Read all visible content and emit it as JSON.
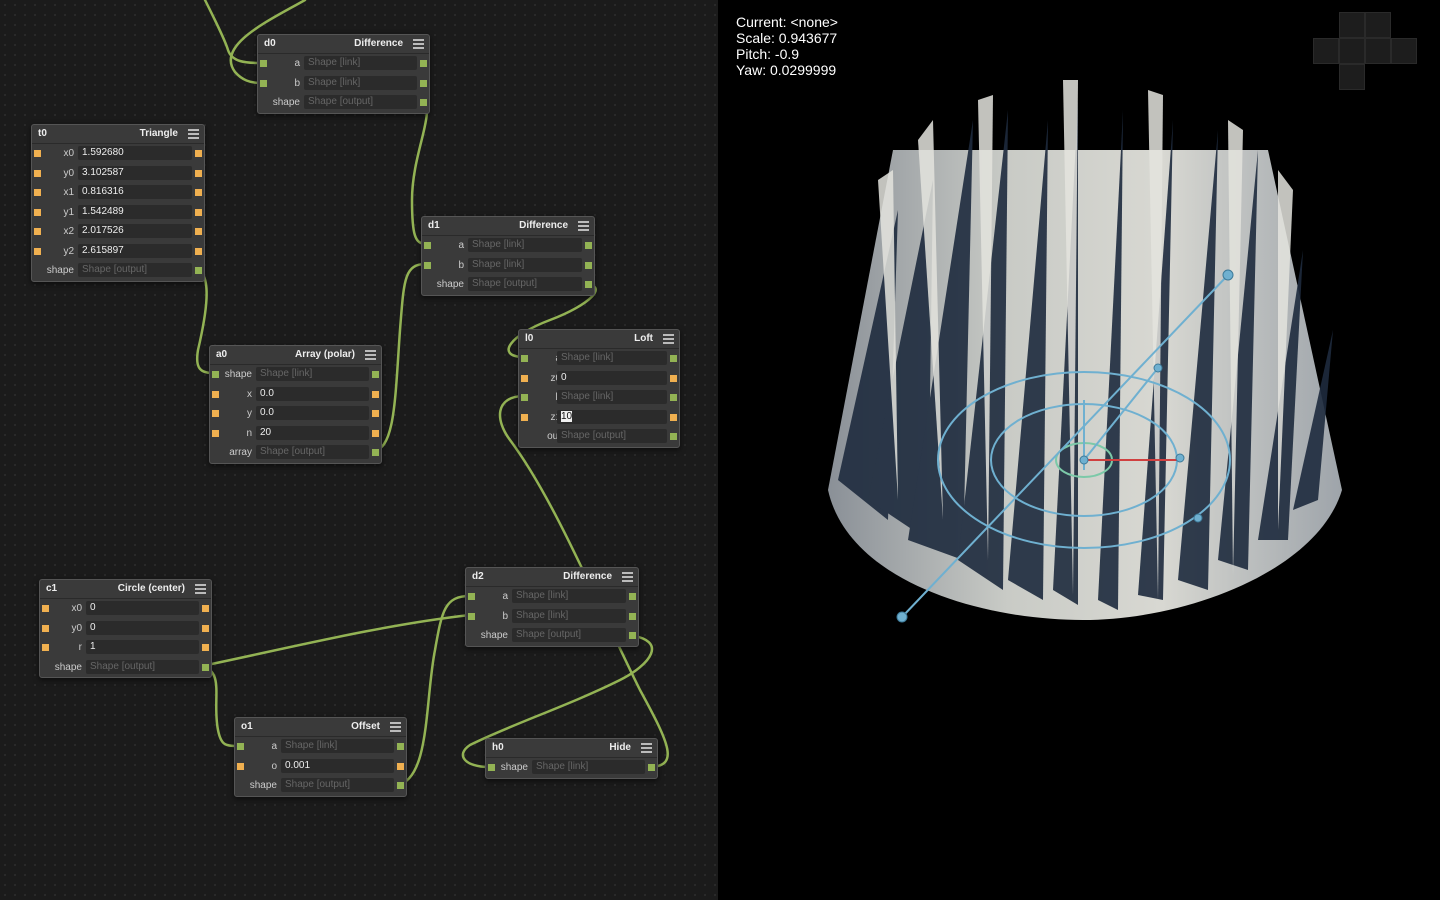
{
  "nodes": {
    "d0": {
      "id": "d0",
      "type": "Difference",
      "rows": [
        {
          "label": "a",
          "value": "Shape [link]"
        },
        {
          "label": "b",
          "value": "Shape [link]"
        },
        {
          "label": "shape",
          "value": "Shape [output]"
        }
      ]
    },
    "t0": {
      "id": "t0",
      "type": "Triangle",
      "rows": [
        {
          "label": "x0",
          "value": "1.592680"
        },
        {
          "label": "y0",
          "value": "3.102587"
        },
        {
          "label": "x1",
          "value": "0.816316"
        },
        {
          "label": "y1",
          "value": "1.542489"
        },
        {
          "label": "x2",
          "value": "2.017526"
        },
        {
          "label": "y2",
          "value": "2.615897"
        },
        {
          "label": "shape",
          "value": "Shape [output]"
        }
      ]
    },
    "d1": {
      "id": "d1",
      "type": "Difference",
      "rows": [
        {
          "label": "a",
          "value": "Shape [link]"
        },
        {
          "label": "b",
          "value": "Shape [link]"
        },
        {
          "label": "shape",
          "value": "Shape [output]"
        }
      ]
    },
    "l0": {
      "id": "l0",
      "type": "Loft",
      "rows": [
        {
          "label": "a",
          "value": "Shape [link]"
        },
        {
          "label": "z0",
          "value": "0"
        },
        {
          "label": "b",
          "value": "Shape [link]"
        },
        {
          "label": "z1",
          "value": "10"
        },
        {
          "label": "out",
          "value": "Shape [output]"
        }
      ]
    },
    "a0": {
      "id": "a0",
      "type": "Array (polar)",
      "rows": [
        {
          "label": "shape",
          "value": "Shape [link]"
        },
        {
          "label": "x",
          "value": "0.0"
        },
        {
          "label": "y",
          "value": "0.0"
        },
        {
          "label": "n",
          "value": "20"
        },
        {
          "label": "array",
          "value": "Shape [output]"
        }
      ]
    },
    "c1": {
      "id": "c1",
      "type": "Circle (center)",
      "rows": [
        {
          "label": "x0",
          "value": "0"
        },
        {
          "label": "y0",
          "value": "0"
        },
        {
          "label": "r",
          "value": "1"
        },
        {
          "label": "shape",
          "value": "Shape [output]"
        }
      ]
    },
    "d2": {
      "id": "d2",
      "type": "Difference",
      "rows": [
        {
          "label": "a",
          "value": "Shape [link]"
        },
        {
          "label": "b",
          "value": "Shape [link]"
        },
        {
          "label": "shape",
          "value": "Shape [output]"
        }
      ]
    },
    "o1": {
      "id": "o1",
      "type": "Offset",
      "rows": [
        {
          "label": "a",
          "value": "Shape [link]"
        },
        {
          "label": "o",
          "value": "0.001"
        },
        {
          "label": "shape",
          "value": "Shape [output]"
        }
      ]
    },
    "h0": {
      "id": "h0",
      "type": "Hide",
      "rows": [
        {
          "label": "shape",
          "value": "Shape [link]"
        }
      ]
    }
  },
  "viewport": {
    "current": "Current: <none>",
    "scale": "Scale: 0.943677",
    "pitch": "Pitch: -0.9",
    "yaw": "Yaw: 0.0299999"
  },
  "colors": {
    "wire": "#93b354",
    "shape_port": "#93b354",
    "number_port": "#f0b050",
    "node_bg": "#3a3a3a",
    "graph_bg": "#1b1b1b",
    "handle": "#6fb0d0",
    "axis_x": "#d04040"
  }
}
